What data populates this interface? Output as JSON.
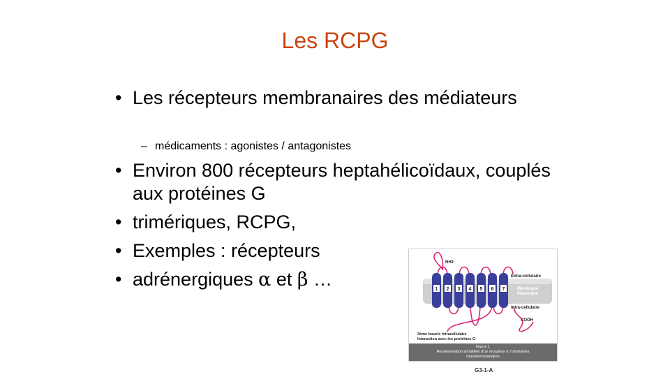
{
  "slide": {
    "title": "Les RCPG",
    "bullets": [
      "Les récepteurs membranaires des médiateurs",
      "Environ 800 récepteurs heptahélicoïdaux, couplés aux protéines G",
      "trimériques, RCPG,",
      "Exemples : récepteurs"
    ],
    "sub_bullet": "médicaments : agonistes / antagonistes",
    "last_bullet": {
      "prefix": "adrénergiques ",
      "alpha": "α",
      "middle": " et ",
      "beta": "β",
      "suffix": " …"
    }
  },
  "figure": {
    "nh2": "NH2",
    "extra": "Extra-cellulaire",
    "membrane_line1": "Membrane",
    "membrane_line2": "Plasmique",
    "intra": "Intra-cellulaire",
    "cooh": "COOH",
    "loop_line1": "3ème boucle intracellulaire",
    "loop_line2": "Interaction avec les protéines G",
    "helix_numbers": [
      "1",
      "2",
      "3",
      "4",
      "5",
      "6",
      "7"
    ],
    "caption_title": "Figure 1",
    "caption_line1": "Représentation simplifiée d'un récepteur à 7 domaines",
    "caption_line2": "transmembranaires",
    "code": "G3-1-A",
    "colors": {
      "helix": "#3b3f9c",
      "loop": "#d9287a",
      "membrane": "#c8c8c8"
    }
  }
}
